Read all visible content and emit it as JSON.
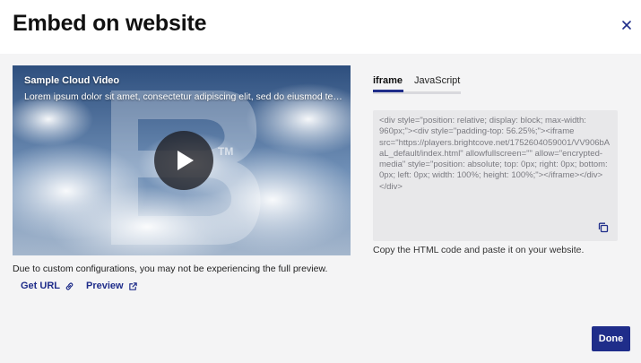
{
  "dialog": {
    "title": "Embed on website",
    "close_icon": "close-icon"
  },
  "video": {
    "title": "Sample Cloud Video",
    "description": "Lorem ipsum dolor sit amet, consectetur adipiscing elit, sed do eiusmod tempor incididunt",
    "trademark": "TM",
    "play_icon": "play-icon"
  },
  "preview_note": "Due to custom configurations, you may not be experiencing the full preview.",
  "links": {
    "get_url": "Get URL",
    "get_url_icon": "link-icon",
    "preview": "Preview",
    "preview_icon": "external-link-icon"
  },
  "tabs": [
    {
      "label": "iframe",
      "active": true
    },
    {
      "label": "JavaScript",
      "active": false
    }
  ],
  "code": "<div style=\"position: relative; display: block; max-width: 960px;\"><div style=\"padding-top: 56.25%;\"><iframe src=\"https://players.brightcove.net/1752604059001/VV906bAaL_default/index.html\" allowfullscreen=\"\" allow=\"encrypted-media\" style=\"position: absolute; top: 0px; right: 0px; bottom: 0px; left: 0px; width: 100%; height: 100%;\"></iframe></div></div>",
  "copy_hint": "Copy the HTML code and paste it on your website.",
  "done_label": "Done",
  "colors": {
    "accent": "#1f2d8a",
    "background": "#f4f4f5",
    "code_bg": "#e8e8ea"
  }
}
